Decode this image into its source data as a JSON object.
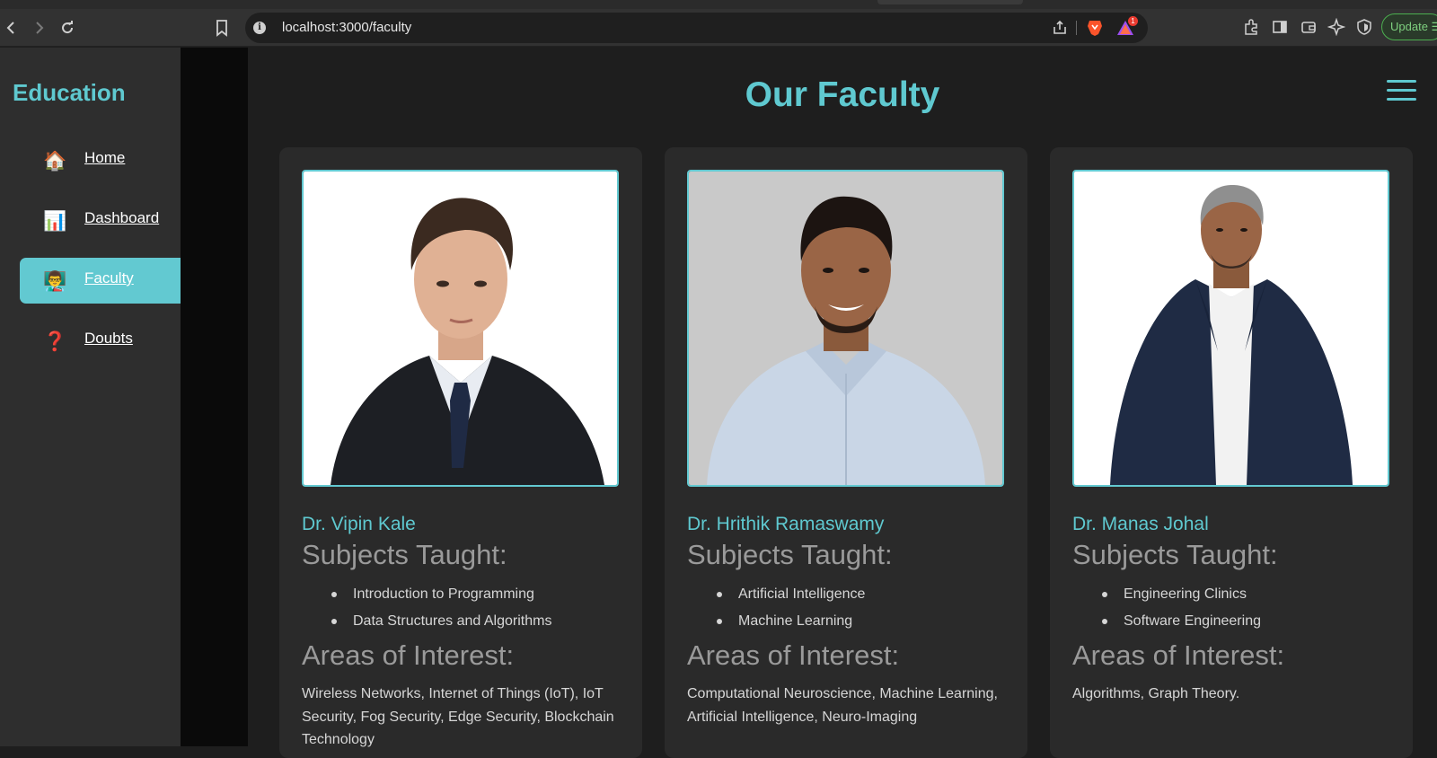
{
  "browser": {
    "url": "localhost:3000/faculty",
    "update_label": "Update",
    "rewards_badge": "1"
  },
  "sidebar": {
    "brand": "Education",
    "items": [
      {
        "label": "Home",
        "icon": "house-icon",
        "emoji": "🏠",
        "active": false
      },
      {
        "label": "Dashboard",
        "icon": "bar-chart-icon",
        "emoji": "📊",
        "active": false
      },
      {
        "label": "Faculty",
        "icon": "teacher-icon",
        "emoji": "👨‍🏫",
        "active": true
      },
      {
        "label": "Doubts",
        "icon": "question-mark-icon",
        "emoji": "❓",
        "active": false
      }
    ]
  },
  "main": {
    "title": "Our Faculty",
    "subjects_heading": "Subjects Taught:",
    "interests_heading": "Areas of Interest:",
    "faculty": [
      {
        "name": "Dr. Vipin Kale",
        "subjects": [
          "Introduction to Programming",
          "Data Structures and Algorithms"
        ],
        "interests": "Wireless Networks, Internet of Things (IoT), IoT Security, Fog Security, Edge Security, Blockchain Technology"
      },
      {
        "name": "Dr. Hrithik Ramaswamy",
        "subjects": [
          "Artificial Intelligence",
          "Machine Learning"
        ],
        "interests": "Computational Neuroscience, Machine Learning, Artificial Intelligence, Neuro-Imaging"
      },
      {
        "name": "Dr. Manas Johal",
        "subjects": [
          "Engineering Clinics",
          "Software Engineering"
        ],
        "interests": "Algorithms, Graph Theory."
      }
    ]
  },
  "colors": {
    "accent": "#5fc9d0",
    "sidebar_bg": "#2e2e2e",
    "card_bg": "#2a2a2a",
    "page_bg": "#1e1e1e"
  }
}
